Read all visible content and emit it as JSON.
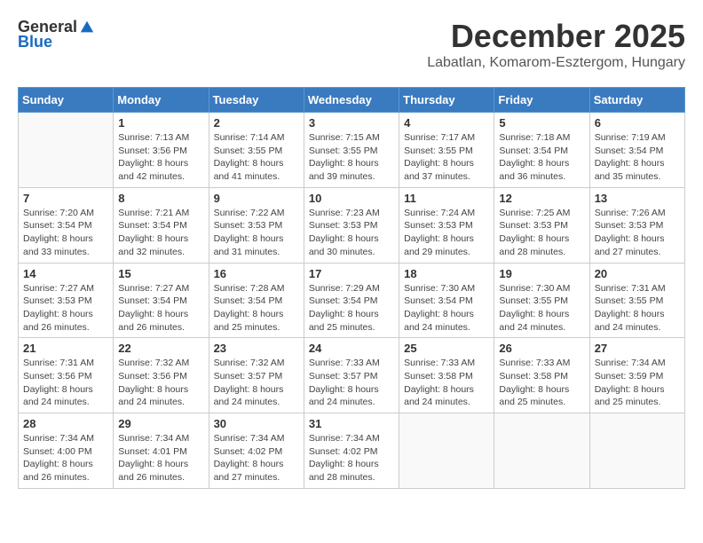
{
  "logo": {
    "general": "General",
    "blue": "Blue"
  },
  "title": "December 2025",
  "subtitle": "Labatlan, Komarom-Esztergom, Hungary",
  "weekdays": [
    "Sunday",
    "Monday",
    "Tuesday",
    "Wednesday",
    "Thursday",
    "Friday",
    "Saturday"
  ],
  "weeks": [
    [
      {
        "day": "",
        "info": ""
      },
      {
        "day": "1",
        "info": "Sunrise: 7:13 AM\nSunset: 3:56 PM\nDaylight: 8 hours\nand 42 minutes."
      },
      {
        "day": "2",
        "info": "Sunrise: 7:14 AM\nSunset: 3:55 PM\nDaylight: 8 hours\nand 41 minutes."
      },
      {
        "day": "3",
        "info": "Sunrise: 7:15 AM\nSunset: 3:55 PM\nDaylight: 8 hours\nand 39 minutes."
      },
      {
        "day": "4",
        "info": "Sunrise: 7:17 AM\nSunset: 3:55 PM\nDaylight: 8 hours\nand 37 minutes."
      },
      {
        "day": "5",
        "info": "Sunrise: 7:18 AM\nSunset: 3:54 PM\nDaylight: 8 hours\nand 36 minutes."
      },
      {
        "day": "6",
        "info": "Sunrise: 7:19 AM\nSunset: 3:54 PM\nDaylight: 8 hours\nand 35 minutes."
      }
    ],
    [
      {
        "day": "7",
        "info": "Sunrise: 7:20 AM\nSunset: 3:54 PM\nDaylight: 8 hours\nand 33 minutes."
      },
      {
        "day": "8",
        "info": "Sunrise: 7:21 AM\nSunset: 3:54 PM\nDaylight: 8 hours\nand 32 minutes."
      },
      {
        "day": "9",
        "info": "Sunrise: 7:22 AM\nSunset: 3:53 PM\nDaylight: 8 hours\nand 31 minutes."
      },
      {
        "day": "10",
        "info": "Sunrise: 7:23 AM\nSunset: 3:53 PM\nDaylight: 8 hours\nand 30 minutes."
      },
      {
        "day": "11",
        "info": "Sunrise: 7:24 AM\nSunset: 3:53 PM\nDaylight: 8 hours\nand 29 minutes."
      },
      {
        "day": "12",
        "info": "Sunrise: 7:25 AM\nSunset: 3:53 PM\nDaylight: 8 hours\nand 28 minutes."
      },
      {
        "day": "13",
        "info": "Sunrise: 7:26 AM\nSunset: 3:53 PM\nDaylight: 8 hours\nand 27 minutes."
      }
    ],
    [
      {
        "day": "14",
        "info": "Sunrise: 7:27 AM\nSunset: 3:53 PM\nDaylight: 8 hours\nand 26 minutes."
      },
      {
        "day": "15",
        "info": "Sunrise: 7:27 AM\nSunset: 3:54 PM\nDaylight: 8 hours\nand 26 minutes."
      },
      {
        "day": "16",
        "info": "Sunrise: 7:28 AM\nSunset: 3:54 PM\nDaylight: 8 hours\nand 25 minutes."
      },
      {
        "day": "17",
        "info": "Sunrise: 7:29 AM\nSunset: 3:54 PM\nDaylight: 8 hours\nand 25 minutes."
      },
      {
        "day": "18",
        "info": "Sunrise: 7:30 AM\nSunset: 3:54 PM\nDaylight: 8 hours\nand 24 minutes."
      },
      {
        "day": "19",
        "info": "Sunrise: 7:30 AM\nSunset: 3:55 PM\nDaylight: 8 hours\nand 24 minutes."
      },
      {
        "day": "20",
        "info": "Sunrise: 7:31 AM\nSunset: 3:55 PM\nDaylight: 8 hours\nand 24 minutes."
      }
    ],
    [
      {
        "day": "21",
        "info": "Sunrise: 7:31 AM\nSunset: 3:56 PM\nDaylight: 8 hours\nand 24 minutes."
      },
      {
        "day": "22",
        "info": "Sunrise: 7:32 AM\nSunset: 3:56 PM\nDaylight: 8 hours\nand 24 minutes."
      },
      {
        "day": "23",
        "info": "Sunrise: 7:32 AM\nSunset: 3:57 PM\nDaylight: 8 hours\nand 24 minutes."
      },
      {
        "day": "24",
        "info": "Sunrise: 7:33 AM\nSunset: 3:57 PM\nDaylight: 8 hours\nand 24 minutes."
      },
      {
        "day": "25",
        "info": "Sunrise: 7:33 AM\nSunset: 3:58 PM\nDaylight: 8 hours\nand 24 minutes."
      },
      {
        "day": "26",
        "info": "Sunrise: 7:33 AM\nSunset: 3:58 PM\nDaylight: 8 hours\nand 25 minutes."
      },
      {
        "day": "27",
        "info": "Sunrise: 7:34 AM\nSunset: 3:59 PM\nDaylight: 8 hours\nand 25 minutes."
      }
    ],
    [
      {
        "day": "28",
        "info": "Sunrise: 7:34 AM\nSunset: 4:00 PM\nDaylight: 8 hours\nand 26 minutes."
      },
      {
        "day": "29",
        "info": "Sunrise: 7:34 AM\nSunset: 4:01 PM\nDaylight: 8 hours\nand 26 minutes."
      },
      {
        "day": "30",
        "info": "Sunrise: 7:34 AM\nSunset: 4:02 PM\nDaylight: 8 hours\nand 27 minutes."
      },
      {
        "day": "31",
        "info": "Sunrise: 7:34 AM\nSunset: 4:02 PM\nDaylight: 8 hours\nand 28 minutes."
      },
      {
        "day": "",
        "info": ""
      },
      {
        "day": "",
        "info": ""
      },
      {
        "day": "",
        "info": ""
      }
    ]
  ]
}
